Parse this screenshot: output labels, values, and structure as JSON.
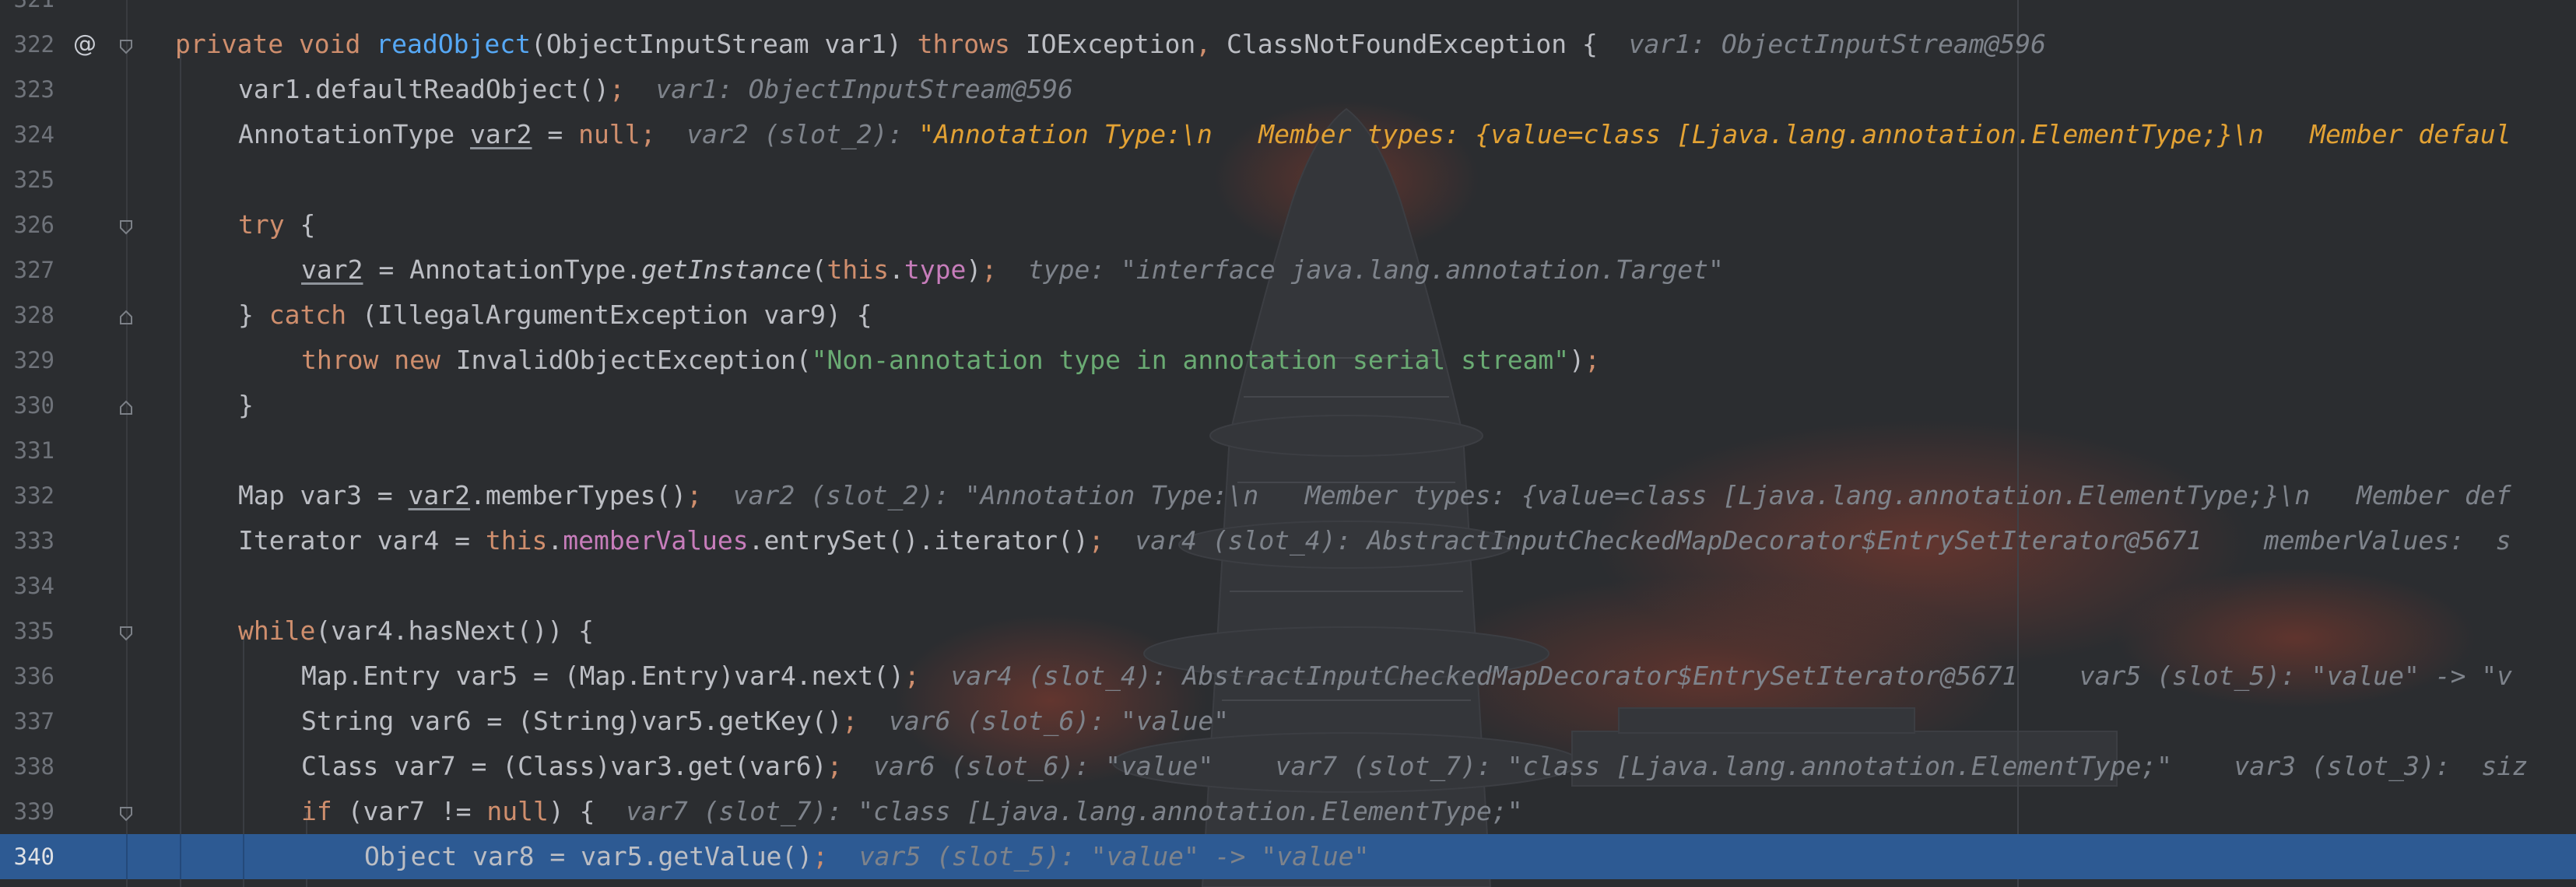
{
  "editor": {
    "lines": [
      {
        "number": "321",
        "kind": "partial"
      },
      {
        "number": "322",
        "annotation": "@",
        "fold": "start",
        "tokens": [
          {
            "t": "private void ",
            "c": "kw"
          },
          {
            "t": "readObject",
            "c": "fn"
          },
          {
            "t": "(ObjectInputStream var1) "
          },
          {
            "t": "throws ",
            "c": "kw"
          },
          {
            "t": "IOException"
          },
          {
            "t": ", ",
            "c": "kw"
          },
          {
            "t": "ClassNotFoundException {  "
          },
          {
            "t": "var1: ObjectInputStream@596",
            "c": "hint"
          }
        ]
      },
      {
        "number": "323",
        "tokens": [
          {
            "t": "var1.defaultReadObject()"
          },
          {
            "t": ";  ",
            "c": "kw"
          },
          {
            "t": "var1: ObjectInputStream@596",
            "c": "hint"
          }
        ]
      },
      {
        "number": "324",
        "tokens": [
          {
            "t": "AnnotationType "
          },
          {
            "t": "var2",
            "c": "ul"
          },
          {
            "t": " = "
          },
          {
            "t": "null",
            "c": "kw"
          },
          {
            "t": ";  ",
            "c": "kw"
          },
          {
            "t": "var2 (slot_2): ",
            "c": "hint"
          },
          {
            "t": "\"Annotation Type:\\n   Member types: {value=class [Ljava.lang.annotation.ElementType;}\\n   Member defaul",
            "c": "hint-s"
          }
        ]
      },
      {
        "number": "325",
        "tokens": []
      },
      {
        "number": "326",
        "fold": "start",
        "tokens": [
          {
            "t": "try ",
            "c": "kw"
          },
          {
            "t": "{"
          }
        ]
      },
      {
        "number": "327",
        "tokens": [
          {
            "t": "var2",
            "c": "ul"
          },
          {
            "t": " = AnnotationType."
          },
          {
            "t": "getInstance",
            "c": "it"
          },
          {
            "t": "("
          },
          {
            "t": "this",
            "c": "kw"
          },
          {
            "t": "."
          },
          {
            "t": "type",
            "c": "fld"
          },
          {
            "t": ")"
          },
          {
            "t": ";  ",
            "c": "kw"
          },
          {
            "t": "type: \"interface java.lang.annotation.Target\"",
            "c": "hint"
          }
        ]
      },
      {
        "number": "328",
        "fold": "end",
        "tokens": [
          {
            "t": "} "
          },
          {
            "t": "catch ",
            "c": "kw"
          },
          {
            "t": "(IllegalArgumentException var9) {"
          }
        ]
      },
      {
        "number": "329",
        "tokens": [
          {
            "t": "throw new ",
            "c": "kw"
          },
          {
            "t": "InvalidObjectException("
          },
          {
            "t": "\"Non-annotation type in annotation serial stream\"",
            "c": "str"
          },
          {
            "t": ")"
          },
          {
            "t": ";",
            "c": "kw"
          }
        ]
      },
      {
        "number": "330",
        "fold": "end",
        "tokens": [
          {
            "t": "}"
          }
        ]
      },
      {
        "number": "331",
        "tokens": []
      },
      {
        "number": "332",
        "tokens": [
          {
            "t": "Map var3 = "
          },
          {
            "t": "var2",
            "c": "ul"
          },
          {
            "t": ".memberTypes()"
          },
          {
            "t": ";  ",
            "c": "kw"
          },
          {
            "t": "var2 (slot_2): \"Annotation Type:\\n   Member types: {value=class [Ljava.lang.annotation.ElementType;}\\n   Member def",
            "c": "hint"
          }
        ]
      },
      {
        "number": "333",
        "tokens": [
          {
            "t": "Iterator var4 = "
          },
          {
            "t": "this",
            "c": "kw"
          },
          {
            "t": "."
          },
          {
            "t": "memberValues",
            "c": "fld"
          },
          {
            "t": ".entrySet().iterator()"
          },
          {
            "t": ";  ",
            "c": "kw"
          },
          {
            "t": "var4 (slot_4): AbstractInputCheckedMapDecorator$EntrySetIterator@5671    memberValues:  s",
            "c": "hint"
          }
        ]
      },
      {
        "number": "334",
        "tokens": []
      },
      {
        "number": "335",
        "fold": "start",
        "tokens": [
          {
            "t": "while",
            "c": "kw"
          },
          {
            "t": "(var4.hasNext()) {"
          }
        ]
      },
      {
        "number": "336",
        "tokens": [
          {
            "t": "Map.Entry var5 = (Map.Entry)var4.next()"
          },
          {
            "t": ";  ",
            "c": "kw"
          },
          {
            "t": "var4 (slot_4): AbstractInputCheckedMapDecorator$EntrySetIterator@5671    var5 (slot_5): \"value\" -> \"v",
            "c": "hint"
          }
        ]
      },
      {
        "number": "337",
        "tokens": [
          {
            "t": "String var6 = (String)var5.getKey()"
          },
          {
            "t": ";  ",
            "c": "kw"
          },
          {
            "t": "var6 (slot_6): \"value\"",
            "c": "hint"
          }
        ]
      },
      {
        "number": "338",
        "tokens": [
          {
            "t": "Class var7 = (Class)var3.get(var6)"
          },
          {
            "t": ";  ",
            "c": "kw"
          },
          {
            "t": "var6 (slot_6): \"value\"    var7 (slot_7): \"class [Ljava.lang.annotation.ElementType;\"    var3 (slot_3):  siz",
            "c": "hint"
          }
        ]
      },
      {
        "number": "339",
        "fold": "start",
        "tokens": [
          {
            "t": "if ",
            "c": "kw"
          },
          {
            "t": "(var7 != "
          },
          {
            "t": "null",
            "c": "kw"
          },
          {
            "t": ") {  "
          },
          {
            "t": "var7 (slot_7): \"class [Ljava.lang.annotation.ElementType;\"",
            "c": "hint"
          }
        ]
      },
      {
        "number": "340",
        "current": true,
        "tokens": [
          {
            "t": "Object var8 = var5.getValue()"
          },
          {
            "t": ";  ",
            "c": "kw"
          },
          {
            "t": "var5 (slot_5): \"value\" -> \"value\"",
            "c": "hint"
          }
        ]
      }
    ]
  }
}
